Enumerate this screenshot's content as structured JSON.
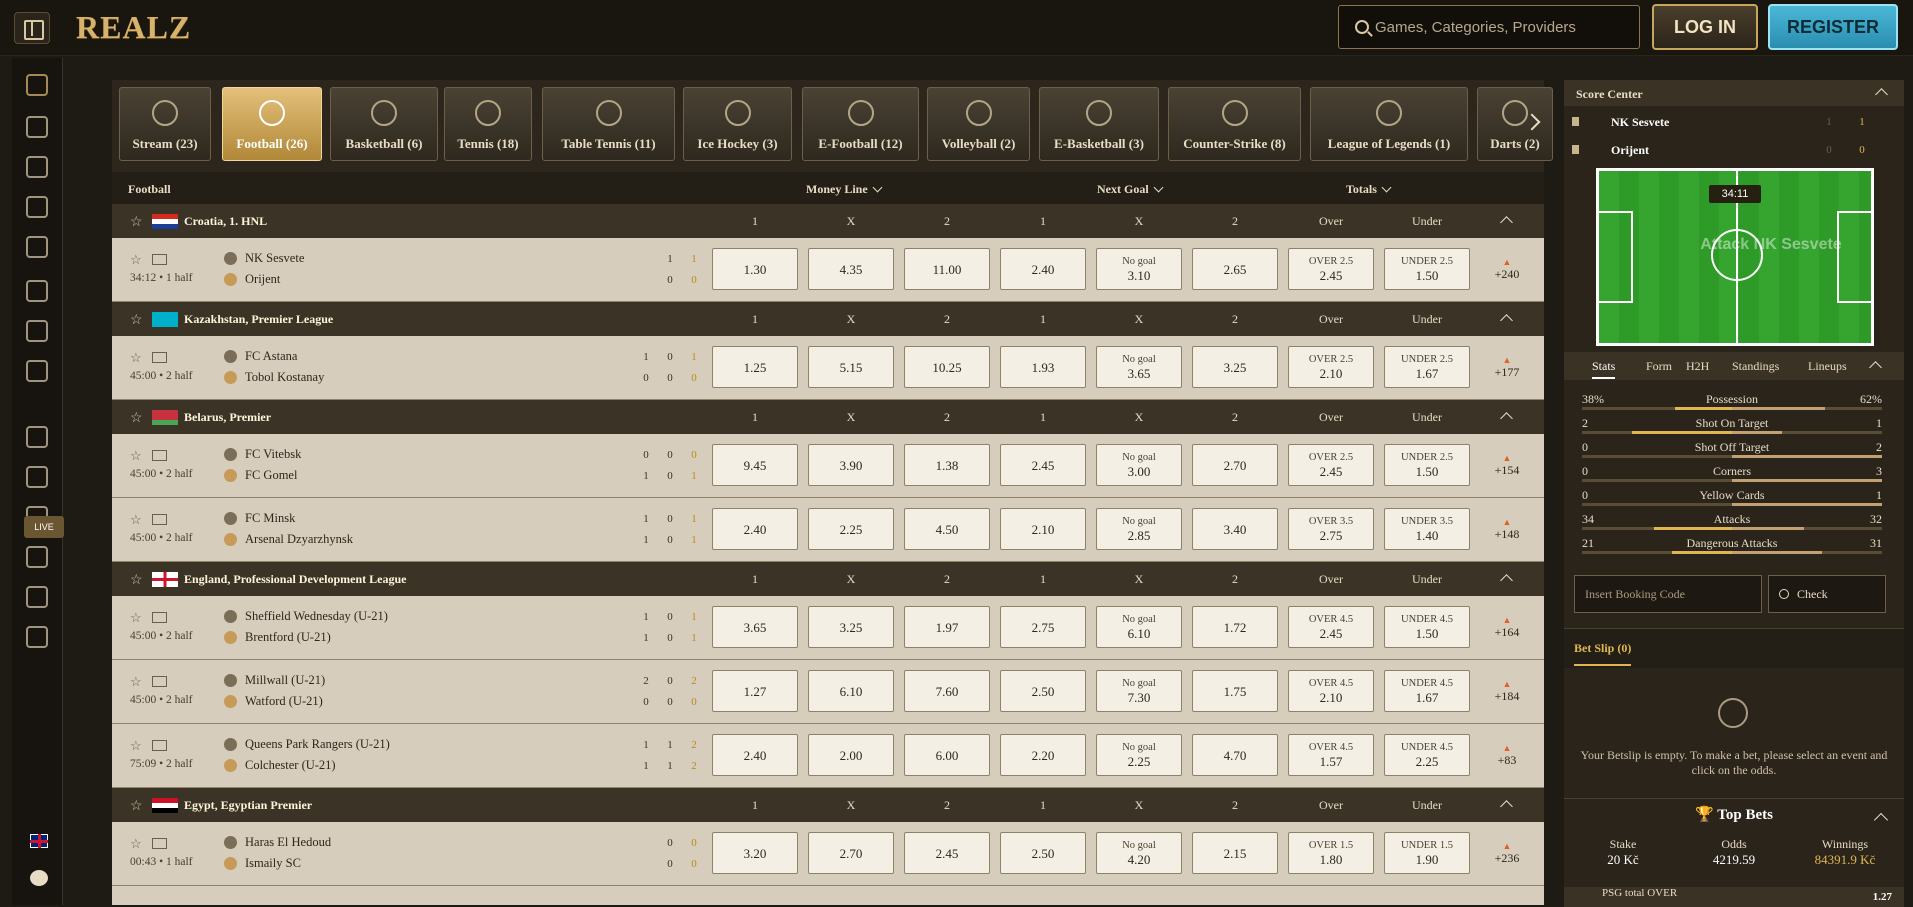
{
  "header": {
    "logo": "REALZ",
    "search_placeholder": "Games, Categories, Providers",
    "login_label": "LOG IN",
    "register_label": "REGISTER"
  },
  "sidebar": {
    "live_label": "LIVE",
    "icons": [
      "crown-icon",
      "egg-icon",
      "gift-icon",
      "casino-icon",
      "slot-icon",
      "cards-icon",
      "clover-icon",
      "basketball-icon",
      "live-icon",
      "dice-icon",
      "wheel-icon",
      "podium-icon",
      "coin-icon",
      "briefcase-icon",
      "diamond-icon"
    ]
  },
  "sports": [
    {
      "label": "Stream (23)",
      "icon": "tv-icon"
    },
    {
      "label": "Football (26)",
      "icon": "football-icon",
      "active": true
    },
    {
      "label": "Basketball (6)",
      "icon": "basketball-icon"
    },
    {
      "label": "Tennis (18)",
      "icon": "tennis-icon"
    },
    {
      "label": "Table Tennis (11)",
      "icon": "table-tennis-icon"
    },
    {
      "label": "Ice Hockey (3)",
      "icon": "ice-hockey-icon"
    },
    {
      "label": "E-Football (12)",
      "icon": "e-football-icon"
    },
    {
      "label": "Volleyball (2)",
      "icon": "volleyball-icon"
    },
    {
      "label": "E-Basketball (3)",
      "icon": "e-basketball-icon"
    },
    {
      "label": "Counter-Strike (8)",
      "icon": "counter-strike-icon"
    },
    {
      "label": "League of Legends (1)",
      "icon": "lol-icon"
    },
    {
      "label": "Darts (2)",
      "icon": "darts-icon"
    }
  ],
  "market_header": {
    "sport": "Football",
    "money_line": "Money Line",
    "next_goal": "Next Goal",
    "totals": "Totals"
  },
  "col_labels": [
    "1",
    "X",
    "2",
    "1",
    "X",
    "2",
    "Over",
    "Under"
  ],
  "leagues": [
    {
      "name": "Croatia, 1. HNL",
      "flag": "croatia",
      "matches": [
        {
          "time": "34:12 • 1 half",
          "home": "NK Sesvete",
          "away": "Orijent",
          "hs": [
            "1",
            "1"
          ],
          "as": [
            "0",
            "0"
          ],
          "odds": [
            "1.30",
            "4.35",
            "11.00",
            "2.40",
            "3.10",
            "2.65",
            "2.45",
            "1.50"
          ],
          "ng": "No goal",
          "over": "OVER 2.5",
          "under": "UNDER 2.5",
          "more": "+240"
        }
      ]
    },
    {
      "name": "Kazakhstan, Premier League",
      "flag": "kazakhstan",
      "matches": [
        {
          "time": "45:00 • 2 half",
          "home": "FC Astana",
          "away": "Tobol Kostanay",
          "hs": [
            "1",
            "0",
            "1"
          ],
          "as": [
            "0",
            "0",
            "0"
          ],
          "odds": [
            "1.25",
            "5.15",
            "10.25",
            "1.93",
            "3.65",
            "3.25",
            "2.10",
            "1.67"
          ],
          "ng": "No goal",
          "over": "OVER 2.5",
          "under": "UNDER 2.5",
          "more": "+177"
        }
      ]
    },
    {
      "name": "Belarus, Premier",
      "flag": "belarus",
      "matches": [
        {
          "time": "45:00 • 2 half",
          "home": "FC Vitebsk",
          "away": "FC Gomel",
          "hs": [
            "0",
            "0",
            "0"
          ],
          "as": [
            "1",
            "0",
            "1"
          ],
          "odds": [
            "9.45",
            "3.90",
            "1.38",
            "2.45",
            "3.00",
            "2.70",
            "2.45",
            "1.50"
          ],
          "ng": "No goal",
          "over": "OVER 2.5",
          "under": "UNDER 2.5",
          "more": "+154"
        },
        {
          "time": "45:00 • 2 half",
          "home": "FC Minsk",
          "away": "Arsenal Dzyarzhynsk",
          "hs": [
            "1",
            "0",
            "1"
          ],
          "as": [
            "1",
            "0",
            "1"
          ],
          "odds": [
            "2.40",
            "2.25",
            "4.50",
            "2.10",
            "2.85",
            "3.40",
            "2.75",
            "1.40"
          ],
          "ng": "No goal",
          "over": "OVER 3.5",
          "under": "UNDER 3.5",
          "more": "+148"
        }
      ]
    },
    {
      "name": "England, Professional Development League",
      "flag": "england",
      "matches": [
        {
          "time": "45:00 • 2 half",
          "home": "Sheffield Wednesday (U-21)",
          "away": "Brentford (U-21)",
          "hs": [
            "1",
            "0",
            "1"
          ],
          "as": [
            "1",
            "0",
            "1"
          ],
          "odds": [
            "3.65",
            "3.25",
            "1.97",
            "2.75",
            "6.10",
            "1.72",
            "2.45",
            "1.50"
          ],
          "ng": "No goal",
          "over": "OVER 4.5",
          "under": "UNDER 4.5",
          "more": "+164"
        },
        {
          "time": "45:00 • 2 half",
          "home": "Millwall (U-21)",
          "away": "Watford (U-21)",
          "hs": [
            "2",
            "0",
            "2"
          ],
          "as": [
            "0",
            "0",
            "0"
          ],
          "odds": [
            "1.27",
            "6.10",
            "7.60",
            "2.50",
            "7.30",
            "1.75",
            "2.10",
            "1.67"
          ],
          "ng": "No goal",
          "over": "OVER 4.5",
          "under": "UNDER 4.5",
          "more": "+184"
        },
        {
          "time": "75:09 • 2 half",
          "home": "Queens Park Rangers (U-21)",
          "away": "Colchester (U-21)",
          "hs": [
            "1",
            "1",
            "2"
          ],
          "as": [
            "1",
            "1",
            "2"
          ],
          "odds": [
            "2.40",
            "2.00",
            "6.00",
            "2.20",
            "2.25",
            "4.70",
            "1.57",
            "2.25"
          ],
          "ng": "No goal",
          "over": "OVER 4.5",
          "under": "UNDER 4.5",
          "more": "+83"
        }
      ]
    },
    {
      "name": "Egypt, Egyptian Premier",
      "flag": "egypt",
      "matches": [
        {
          "time": "00:43 • 1 half",
          "home": "Haras El Hedoud",
          "away": "Ismaily SC",
          "hs": [
            "0",
            "0"
          ],
          "as": [
            "0",
            "0"
          ],
          "odds": [
            "3.20",
            "2.70",
            "2.45",
            "2.50",
            "4.20",
            "2.15",
            "1.80",
            "1.90"
          ],
          "ng": "No goal",
          "over": "OVER 1.5",
          "under": "UNDER 1.5",
          "more": "+236"
        }
      ]
    }
  ],
  "score_center": {
    "title": "Score Center",
    "home": "NK Sesvete",
    "away": "Orijent",
    "home_scores": [
      "1",
      "1"
    ],
    "away_scores": [
      "0",
      "0"
    ],
    "time": "34:11",
    "attack_text": "Attack NK Sesvete",
    "tabs": [
      "Stats",
      "Form",
      "H2H",
      "Standings",
      "Lineups"
    ],
    "stats": [
      {
        "label": "Possession",
        "home": "38%",
        "away": "62%",
        "hf": 0.38,
        "af": 0.62
      },
      {
        "label": "Shot On Target",
        "home": "2",
        "away": "1",
        "hf": 0.67,
        "af": 0.33
      },
      {
        "label": "Shot Off Target",
        "home": "0",
        "away": "2",
        "hf": 0,
        "af": 1
      },
      {
        "label": "Corners",
        "home": "0",
        "away": "3",
        "hf": 0,
        "af": 1
      },
      {
        "label": "Yellow Cards",
        "home": "0",
        "away": "1",
        "hf": 0,
        "af": 1
      },
      {
        "label": "Attacks",
        "home": "34",
        "away": "32",
        "hf": 0.52,
        "af": 0.48
      },
      {
        "label": "Dangerous Attacks",
        "home": "21",
        "away": "31",
        "hf": 0.4,
        "af": 0.6
      }
    ]
  },
  "booking": {
    "placeholder": "Insert Booking Code",
    "check": "Check"
  },
  "betslip": {
    "label": "Bet Slip (0)",
    "empty": "Your Betslip is empty. To make a bet, please select an event and click on the odds."
  },
  "top_bets": {
    "title": "Top Bets",
    "stake_label": "Stake",
    "stake": "20 Kč",
    "odds_label": "Odds",
    "odds": "4219.59",
    "win_label": "Winnings",
    "win": "84391.9 Kč",
    "item": "PSG total OVER",
    "item_odds": "1.27"
  },
  "colors": {
    "accent": "#e0b652",
    "register": "#3aa7c9"
  }
}
